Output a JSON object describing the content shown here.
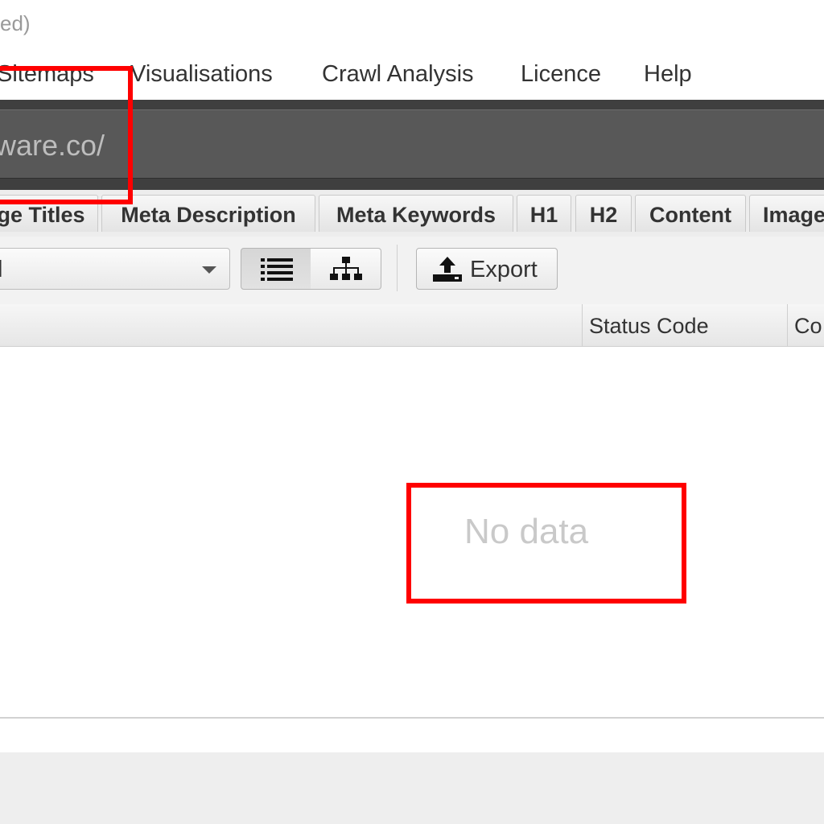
{
  "window": {
    "title_fragment": "ed)"
  },
  "menu": {
    "items": [
      "Sitemaps",
      "Visualisations",
      "Crawl Analysis",
      "Licence",
      "Help"
    ]
  },
  "url_bar": {
    "value_fragment": "ware.co/"
  },
  "tabs": [
    "ge Titles",
    "Meta Description",
    "Meta Keywords",
    "H1",
    "H2",
    "Content",
    "Image"
  ],
  "toolbar": {
    "filter_value": "l",
    "view_list_icon": "list-icon",
    "view_tree_icon": "sitemap-tree-icon",
    "export_label": "Export",
    "export_icon": "upload-tray-icon"
  },
  "table": {
    "columns": [
      "",
      "Status Code",
      "Co"
    ],
    "empty_message": "No data"
  },
  "colors": {
    "annotation": "#ff0000",
    "url_bar_bg": "#585858",
    "empty_text": "#c9c9c9"
  }
}
